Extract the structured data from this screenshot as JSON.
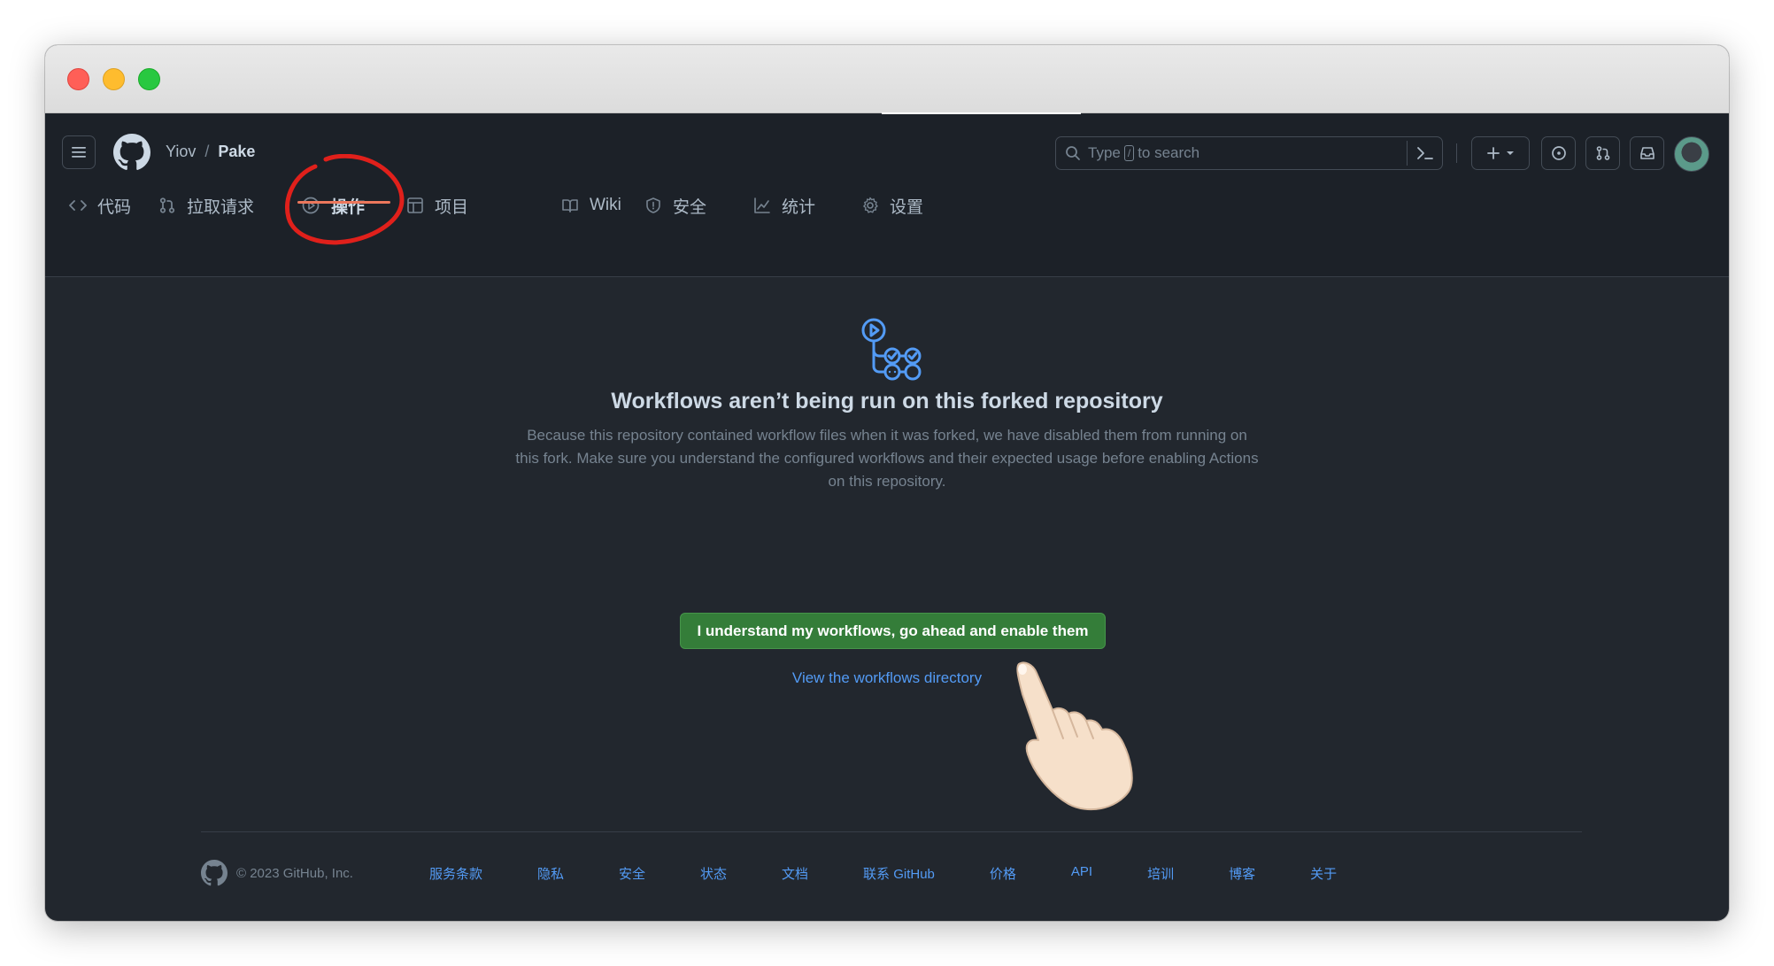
{
  "breadcrumb": {
    "owner": "Yiov",
    "separator": "/",
    "repo": "Pake"
  },
  "search": {
    "prefix": "Type",
    "key": "/",
    "suffix": "to search"
  },
  "tabs": [
    {
      "label": "代码",
      "icon": "code-icon"
    },
    {
      "label": "拉取请求",
      "icon": "pull-request-icon"
    },
    {
      "label": "操作",
      "icon": "play-icon",
      "active": true
    },
    {
      "label": "项目",
      "icon": "table-icon"
    },
    {
      "label": "Wiki",
      "icon": "book-icon"
    },
    {
      "label": "安全",
      "icon": "shield-icon"
    },
    {
      "label": "统计",
      "icon": "graph-icon"
    },
    {
      "label": "设置",
      "icon": "gear-icon"
    }
  ],
  "main": {
    "title": "Workflows aren’t being run on this forked repository",
    "description": "Because this repository contained workflow files when it was forked, we have disabled them from running on this fork. Make sure you understand the configured workflows and their expected usage before enabling Actions on this repository.",
    "enable_button": "I understand my workflows, go ahead and enable them",
    "directory_link": "View the workflows directory"
  },
  "footer": {
    "copyright": "© 2023 GitHub, Inc.",
    "links": [
      "服务条款",
      "隐私",
      "安全",
      "状态",
      "文档",
      "联系 GitHub",
      "价格",
      "API",
      "培训",
      "博客",
      "关于"
    ]
  },
  "colors": {
    "background": "#22272e",
    "header": "#1c2128",
    "accent_green": "#347d39",
    "link_blue": "#539bf5",
    "annotation_red": "#e0201b"
  }
}
